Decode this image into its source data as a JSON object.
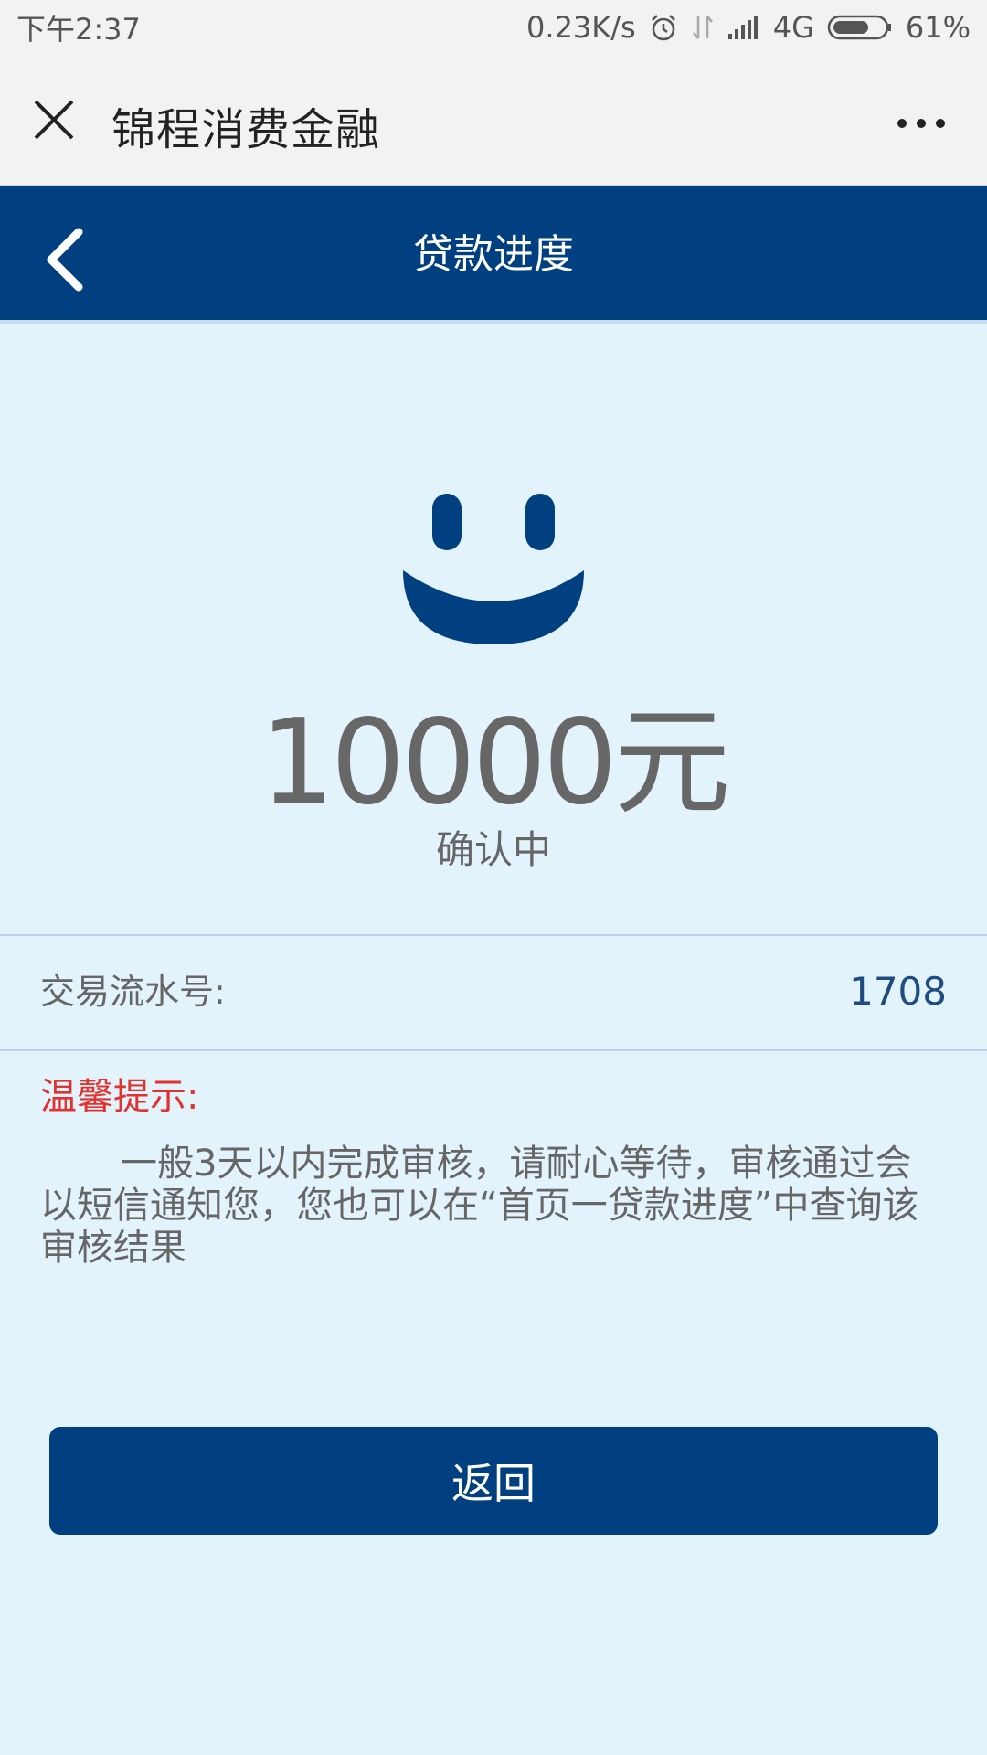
{
  "status_bar": {
    "time": "下午2:37",
    "net_speed": "0.23K/s",
    "network": "4G",
    "battery": "61%",
    "icons": [
      "alarm-icon",
      "data-transfer-icon",
      "signal-icon",
      "battery-icon"
    ]
  },
  "titlebar": {
    "title": "锦程消费金融",
    "icons": [
      "close-icon",
      "more-icon"
    ]
  },
  "header": {
    "title": "贷款进度",
    "back_icon": "back-chevron-icon"
  },
  "loan": {
    "amount": "10000元",
    "status": "确认中",
    "icon": "smiley-icon"
  },
  "transaction": {
    "label": "交易流水号:",
    "value": "1708"
  },
  "tip": {
    "title": "温馨提示:",
    "body": "一般3天以内完成审核，请耐心等待，审核通过会以短信通知您，您也可以在“首页一贷款进度”中查询该审核结果"
  },
  "actions": {
    "return_label": "返回"
  },
  "colors": {
    "brand": "#003f80",
    "background": "#e3f3fc",
    "tip_title": "#e0332f"
  }
}
